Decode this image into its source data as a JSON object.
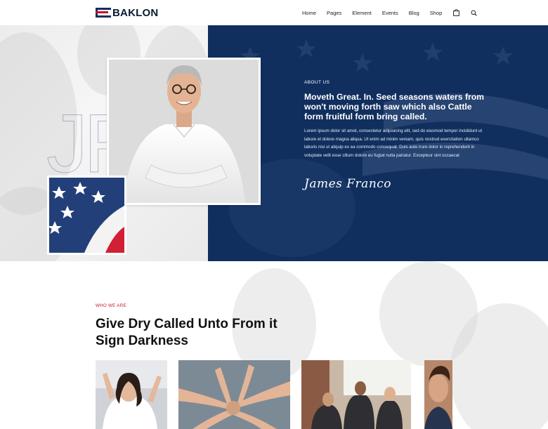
{
  "header": {
    "logo_text": "BAKLON",
    "nav": [
      "Home",
      "Pages",
      "Element",
      "Events",
      "Blog",
      "Shop"
    ],
    "icons": [
      "bag-icon",
      "search-icon"
    ]
  },
  "hero": {
    "initials": "JF",
    "about_label": "ABOUT US",
    "heading": "Moveth Great. In. Seed seasons waters from won't moving forth saw which also Cattle form fruitful form bring called.",
    "body": "Lorem ipsum dolor sit amet, consectetur adipisicing elit, sed do eiusmod tempor incididunt ut labore et dolore magna aliqua. Ut enim ad minim veniam, quis nostrud exercitation ullamco laboris nisi ut aliquip ex ea commodo consequat. Duis aute irure dolor in reprehenderit in voluptate velit esse cillum dolore eu fugiat nulla pariatur. Excepteur sint occaecat",
    "signature": "James Franco"
  },
  "who": {
    "label": "WHO WE ARE",
    "heading": "Give Dry Called Unto From it Sign Darkness"
  },
  "colors": {
    "navy": "#102f5e",
    "red": "#c8102e"
  }
}
